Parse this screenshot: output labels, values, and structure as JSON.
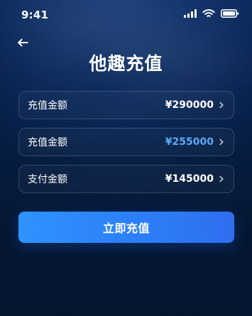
{
  "status_bar": {
    "time": "9:41",
    "icons": [
      "cellular-signal-icon",
      "wifi-icon",
      "battery-icon"
    ]
  },
  "header": {
    "back_icon": "back-arrow-icon",
    "title": "他趣充值"
  },
  "rows": [
    {
      "label": "充值金额",
      "value": "¥290000",
      "value_color": "#ffffff",
      "chevron_icon": "chevron-right-icon"
    },
    {
      "label": "充值金额",
      "value": "¥255000",
      "value_color": "#5aaaf6",
      "chevron_icon": "chevron-right-icon"
    },
    {
      "label": "支付金额",
      "value": "¥145000",
      "value_color": "#ffffff",
      "chevron_icon": "chevron-right-icon"
    }
  ],
  "actions": {
    "primary_label": "立即充值"
  },
  "theme": {
    "background": "#0b2a5b",
    "accent": "#2f7ff6",
    "text": "#ffffff"
  }
}
